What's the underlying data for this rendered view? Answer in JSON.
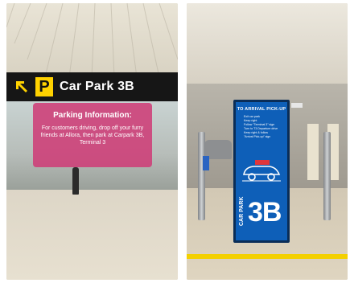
{
  "left_photo": {
    "sign": {
      "arrow_icon": "arrow-up-left-icon",
      "p_letter": "P",
      "text": "Car Park 3B"
    },
    "info": {
      "title": "Parking Information:",
      "body": "For customers driving, drop off your furry friends at Allora, then park at Carpark 3B, Terminal 3"
    },
    "colors": {
      "sign_bg": "#161616",
      "p_badge": "#ffd200",
      "info_box": "#ce3d78"
    }
  },
  "right_photo": {
    "totem": {
      "title": "TO ARRIVAL PICK-UP",
      "steps": [
        "Exit car park",
        "Keep right",
        "Follow \"Terminal 3\" sign",
        "Turn to T3 Departure drive",
        "Keep right & follow",
        "\"Arrival Pick-up\" sign"
      ],
      "vertical_label": "CAR PARK",
      "big_label": "3B",
      "car_icon": "car-icon"
    },
    "colors": {
      "totem_bg": "#0e5fb8",
      "floor_line": "#f3d000"
    }
  }
}
